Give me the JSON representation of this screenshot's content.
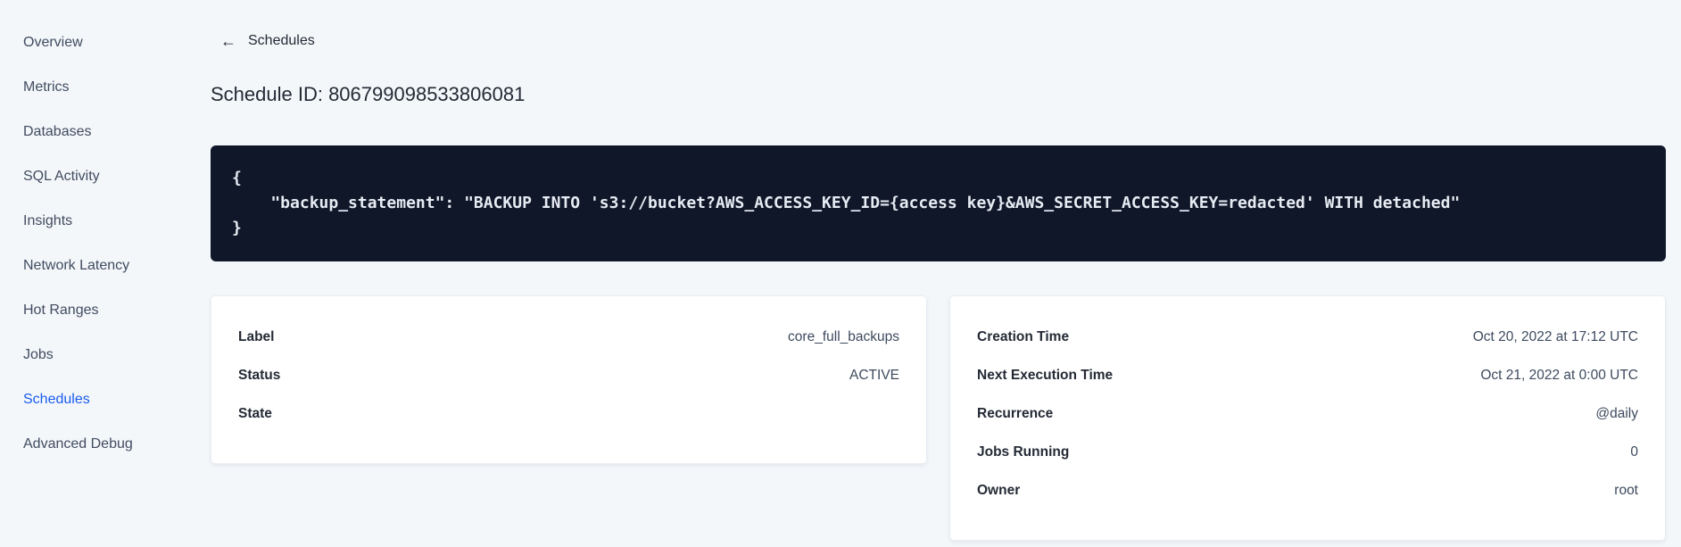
{
  "colors": {
    "page_background": "#f4f7fa",
    "accent_blue": "#1a5cf0",
    "code_block_background": "#0f1729",
    "code_text": "#e7ecf3",
    "heading_text": "#242a35",
    "body_text": "#3d4a5e",
    "sidebar_text": "#404c60",
    "card_background": "#ffffff"
  },
  "icons": {
    "back_arrow": "←"
  },
  "sidebar": {
    "items": [
      {
        "label": "Overview",
        "active": false
      },
      {
        "label": "Metrics",
        "active": false
      },
      {
        "label": "Databases",
        "active": false
      },
      {
        "label": "SQL Activity",
        "active": false
      },
      {
        "label": "Insights",
        "active": false
      },
      {
        "label": "Network Latency",
        "active": false
      },
      {
        "label": "Hot Ranges",
        "active": false
      },
      {
        "label": "Jobs",
        "active": false
      },
      {
        "label": "Schedules",
        "active": true
      },
      {
        "label": "Advanced Debug",
        "active": false
      }
    ]
  },
  "header": {
    "back_label": "Schedules",
    "title": "Schedule ID: 806799098533806081"
  },
  "code_block": {
    "content": "{\n    \"backup_statement\": \"BACKUP INTO 's3://bucket?AWS_ACCESS_KEY_ID={access key}&AWS_SECRET_ACCESS_KEY=redacted' WITH detached\"\n}"
  },
  "cards": {
    "left": {
      "rows": [
        {
          "label": "Label",
          "value": "core_full_backups"
        },
        {
          "label": "Status",
          "value": "ACTIVE"
        },
        {
          "label": "State",
          "value": ""
        }
      ]
    },
    "right": {
      "rows": [
        {
          "label": "Creation Time",
          "value": "Oct 20, 2022 at 17:12 UTC"
        },
        {
          "label": "Next Execution Time",
          "value": "Oct 21, 2022 at 0:00 UTC"
        },
        {
          "label": "Recurrence",
          "value": "@daily"
        },
        {
          "label": "Jobs Running",
          "value": "0"
        },
        {
          "label": "Owner",
          "value": "root"
        }
      ]
    }
  }
}
